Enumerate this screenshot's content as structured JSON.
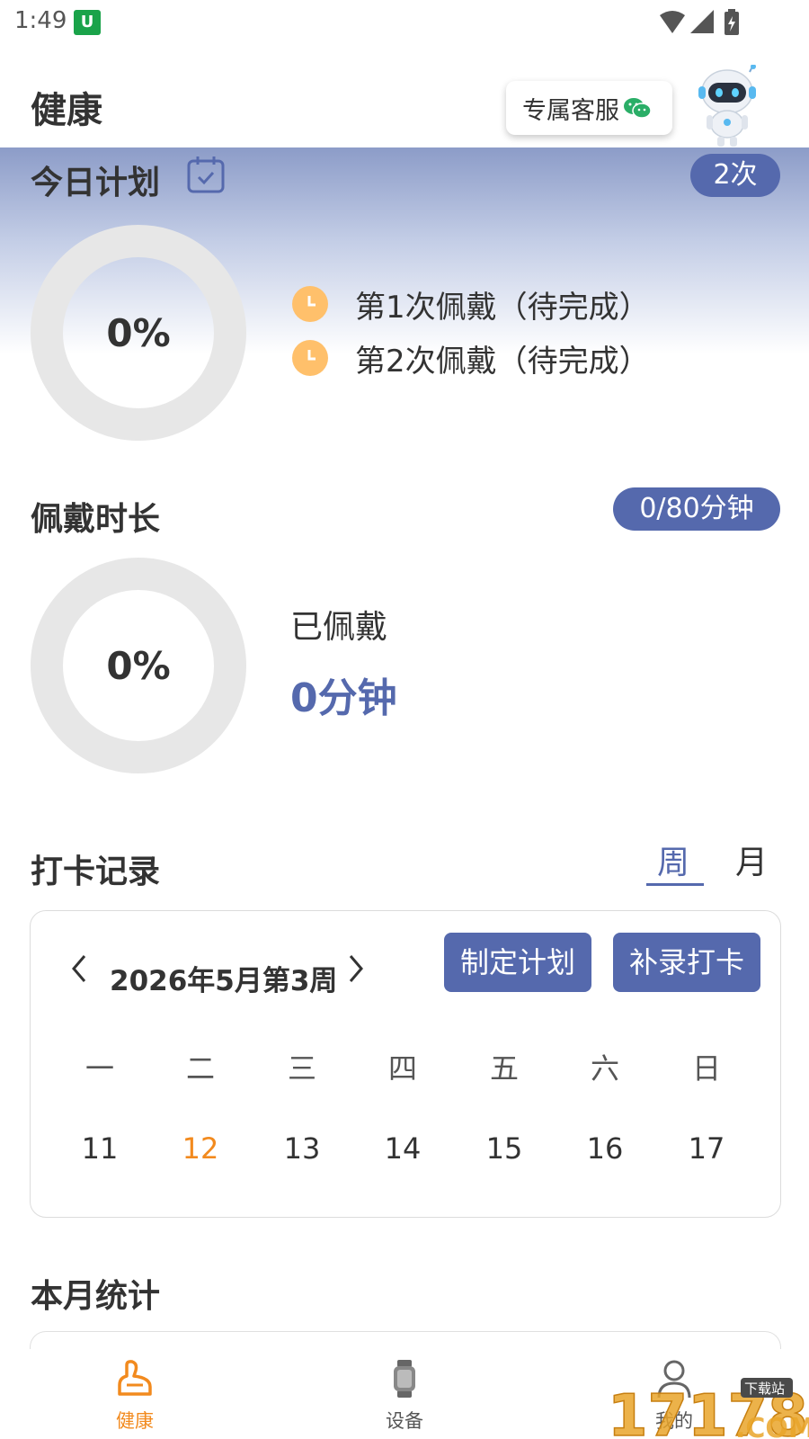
{
  "status_bar": {
    "time": "1:49",
    "app_icon_letter": "U"
  },
  "header": {
    "title": "健康",
    "service_label": "专属客服"
  },
  "today_plan": {
    "title": "今日计划",
    "count_badge": "2次",
    "progress_text": "0%",
    "items": [
      {
        "label": "第1次佩戴（待完成）"
      },
      {
        "label": "第2次佩戴（待完成）"
      }
    ]
  },
  "wear_duration": {
    "title": "佩戴时长",
    "badge": "0/80分钟",
    "progress_text": "0%",
    "worn_label": "已佩戴",
    "worn_value": "0分钟"
  },
  "checkin": {
    "title": "打卡记录",
    "tabs": [
      {
        "label": "周",
        "active": true
      },
      {
        "label": "月",
        "active": false
      }
    ],
    "week_label": "2026年5月第3周",
    "make_plan_button": "制定计划",
    "makeup_button": "补录打卡",
    "weekdays": [
      "一",
      "二",
      "三",
      "四",
      "五",
      "六",
      "日"
    ],
    "days": [
      "11",
      "12",
      "13",
      "14",
      "15",
      "16",
      "17"
    ],
    "today_index": 1
  },
  "monthly_stats": {
    "title": "本月统计"
  },
  "bottom_nav": [
    {
      "label": "健康",
      "icon": "health-icon",
      "active": true
    },
    {
      "label": "设备",
      "icon": "watch-icon",
      "active": false
    },
    {
      "label": "我的",
      "icon": "person-icon",
      "active": false
    }
  ],
  "watermark": {
    "text": "17178",
    "tag": "下载站",
    "suffix": ".COM"
  },
  "colors": {
    "primary": "#5569ad",
    "accent": "#f28a1e",
    "clock": "#ffc06b",
    "ring": "#e7e7e7"
  }
}
